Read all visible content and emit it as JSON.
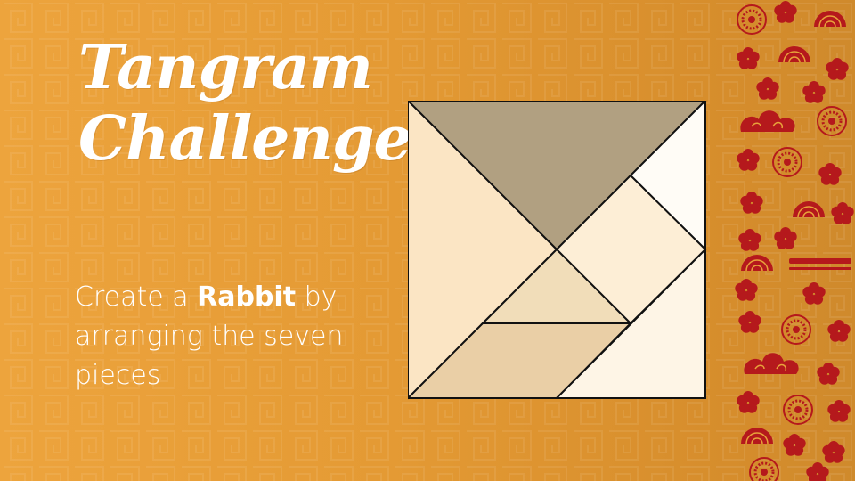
{
  "title": {
    "line1": "Tangram",
    "line2": "Challenge"
  },
  "subtitle": {
    "before": "Create a ",
    "emphasis": "Rabbit",
    "after": " by arranging the seven pieces"
  },
  "tangram": {
    "piece_count": 7,
    "colors": [
      "#b1a081",
      "#fbe5c4",
      "#fffcf6",
      "#fdeed6",
      "#f1ddb9",
      "#eacfa6",
      "#fef5e6"
    ]
  },
  "decoration": {
    "motif": "red-floral-cloud-pattern",
    "color": "#b5191c"
  },
  "background": {
    "color": "#e59c35",
    "motif": "chinese-fret-pattern"
  }
}
